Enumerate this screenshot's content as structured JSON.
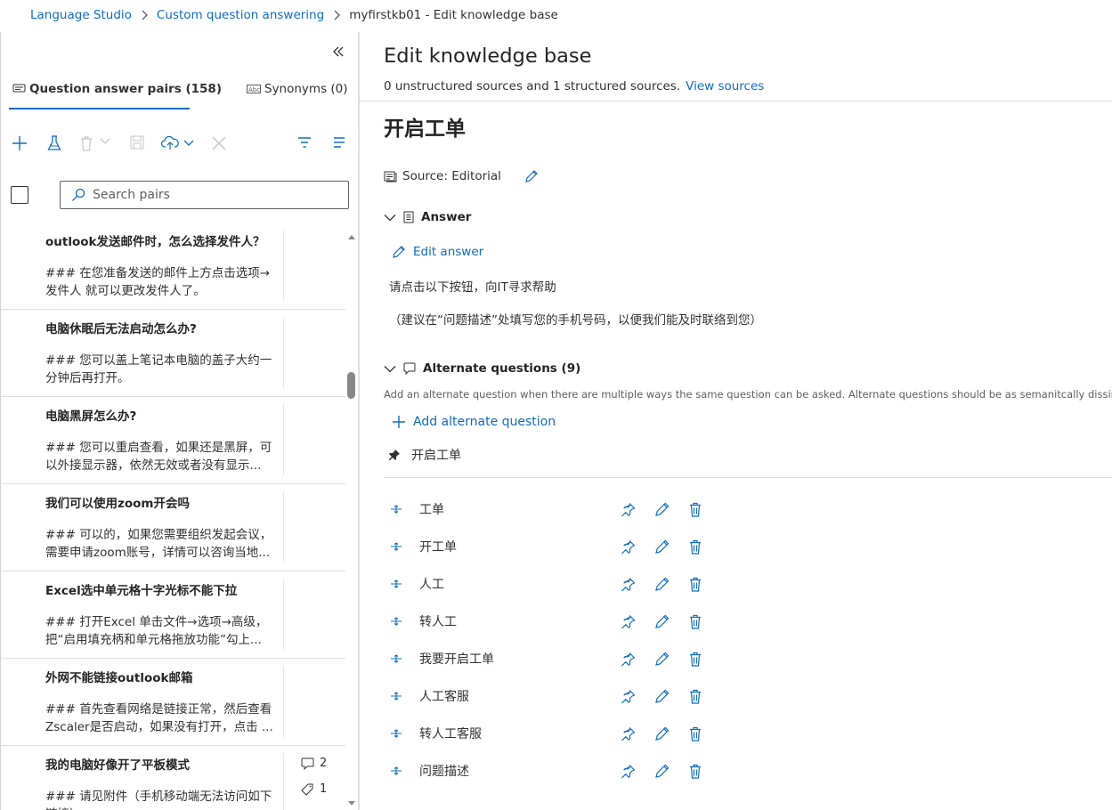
{
  "breadcrumb": [
    "Language Studio",
    "Custom question answering",
    "myfirstkb01 - Edit knowledge base"
  ],
  "left": {
    "tabs": [
      {
        "label": "Question answer pairs (158)",
        "icon": "qna-icon"
      },
      {
        "label": "Synonyms (0)",
        "icon": "abc-icon"
      }
    ],
    "toolbar": [
      "add-icon",
      "test-flask-icon",
      "delete-icon",
      "save-icon",
      "cloud-deploy-icon",
      "close-icon",
      "filter-icon",
      "list-view-icon"
    ],
    "search_placeholder": "Search pairs",
    "items": [
      {
        "q": "outlook发送邮件时，怎么选择发件人？",
        "a": "### 在您准备发送的邮件上方点击选项→发件人 就可以更改发件人了。"
      },
      {
        "q": "电脑休眠后无法启动怎么办?",
        "a": "### 您可以盖上笔记本电脑的盖子大约一分钟后再打开。"
      },
      {
        "q": "电脑黑屏怎么办?",
        "a": "### 您可以重启查看，如果还是黑屏，可以外接显示器，依然无效或者没有显示..."
      },
      {
        "q": "我们可以使用zoom开会吗",
        "a": "### 可以的，如果您需要组织发起会议，需要申请zoom账号，详情可以咨询当地..."
      },
      {
        "q": "Excel选中单元格十字光标不能下拉",
        "a": "### 打开Excel 单击文件→选项→高级，把“启用填充柄和单元格拖放功能”勾上..."
      },
      {
        "q": "外网不能链接outlook邮箱",
        "a": "### 首先查看网络是链接正常，然后查看Zscaler是否启动，如果没有打开，点击 ..."
      },
      {
        "q": "我的电脑好像开了平板模式",
        "a": "### 请见附件（手机移动端无法访问如下链接）",
        "prompts": "2",
        "tags": "1"
      }
    ]
  },
  "right": {
    "title": "Edit knowledge base",
    "sources_text": "0 unstructured sources and 1 structured sources.",
    "view_sources": "View sources",
    "question": "开启工单",
    "source_label": "Source: Editorial",
    "answer_header": "Answer",
    "edit_answer": "Edit answer",
    "answer_line1": "请点击以下按钮，向IT寻求帮助",
    "answer_line2": "（建议在“问题描述”处填写您的手机号码，以便我们能及时联络到您）",
    "alt_header": "Alternate questions (9)",
    "alt_desc": "Add an alternate question when there are multiple ways the same question can be asked. Alternate questions should be as semanitcally dissimilar as possible",
    "add_alt": "Add alternate question",
    "pinned_question": "开启工单",
    "alternates": [
      "工单",
      "开工单",
      "人工",
      "转人工",
      "我要开启工单",
      "人工客服",
      "转人工客服",
      "问题描述"
    ]
  },
  "colors": {
    "accent": "#0f6cbd",
    "text": "#323130",
    "divider": "#e1dfdd"
  }
}
